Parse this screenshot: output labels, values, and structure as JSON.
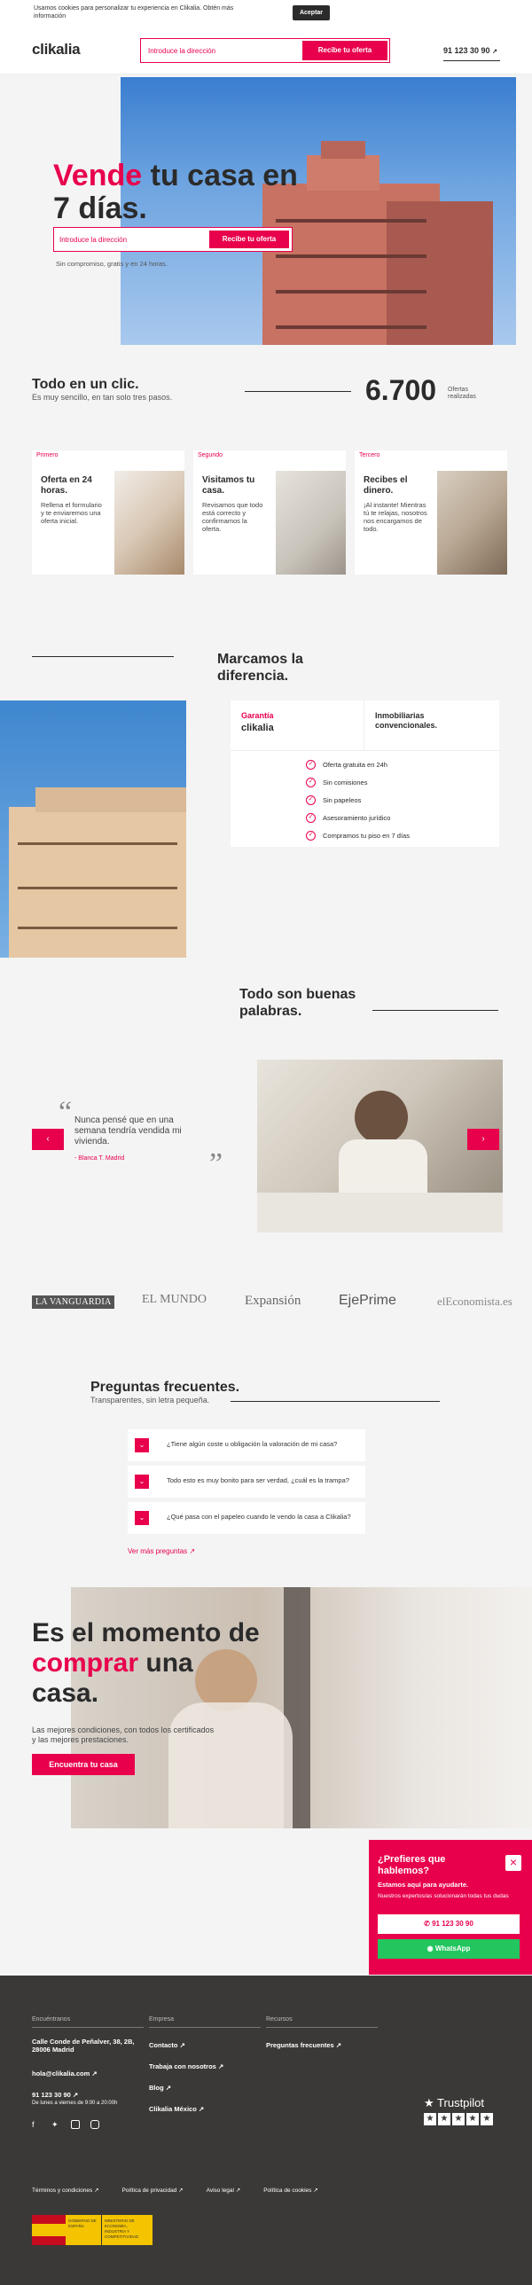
{
  "cookie": {
    "text": "Usamos cookies para personalizar tu experiencia en Clikalia. Obtén más información",
    "accept": "Aceptar"
  },
  "header": {
    "logo": "clikalia",
    "search_placeholder": "Introduce la dirección",
    "search_button": "Recibe tu oferta",
    "phone": "91 123 30 90"
  },
  "hero": {
    "title_highlight": "Vende",
    "title_rest": " tu casa en 7 días.",
    "search_placeholder": "Introduce la dirección",
    "search_button": "Recibe tu oferta",
    "subtitle": "Sin compromiso, gratis y en 24 horas."
  },
  "intro": {
    "title": "Todo en un clic.",
    "subtitle": "Es muy sencillo, en tan solo tres pasos.",
    "count": "6.700",
    "count_label": "Ofertas realizadas"
  },
  "steps": [
    {
      "label": "Primero",
      "title": "Oferta en 24 horas.",
      "desc": "Rellena el formulario y te enviaremos una oferta inicial."
    },
    {
      "label": "Segundo",
      "title": "Visitamos tu casa.",
      "desc": "Revisamos que todo está correcto y confirmamos la oferta."
    },
    {
      "label": "Tercero",
      "title": "Recibes el dinero.",
      "desc": "¡Al instante! Mientras tú te relajas, nosotros nos encargamos de todo."
    }
  ],
  "difference": {
    "title": "Marcamos la diferencia.",
    "col1_title": "Garantía",
    "col1_logo": "clikalia",
    "col2_title": "Inmobiliarias convencionales.",
    "rows": [
      "Oferta gratuita en 24h",
      "Sin comisiones",
      "Sin papeleos",
      "Asesoramiento jurídico",
      "Compramos tu piso en 7 días"
    ]
  },
  "testimonials": {
    "title": "Todo son buenas palabras.",
    "quote": "Nunca pensé que en una semana tendría vendida mi vivienda.",
    "author": "- Blanca T. Madrid",
    "prev": "‹",
    "next": "›"
  },
  "press": [
    "LA VANGUARDIA",
    "EL MUNDO",
    "Expansión",
    "EjePrime",
    "elEconomista.es"
  ],
  "faq": {
    "title": "Preguntas frecuentes.",
    "subtitle": "Transparentes, sin letra pequeña.",
    "questions": [
      "¿Tiene algún coste u obligación la valoración de mi casa?",
      "Todo esto es muy bonito para ser verdad, ¿cuál es la trampa?",
      "¿Qué pasa con el papeleo cuando le vendo la casa a Clikalia?"
    ],
    "more": "Ver más preguntas"
  },
  "cta": {
    "line1": "Es el momento de",
    "line2_highlight": "comprar",
    "line2_rest": " una",
    "line3": "casa.",
    "desc": "Las mejores condiciones, con todos los certificados y las mejores prestaciones.",
    "button": "Encuentra tu casa"
  },
  "contact": {
    "title": "¿Prefieres que hablemos?",
    "subtitle": "Estamos aquí para ayudarte.",
    "desc": "Nuestros expertos/as solucionarán todas tus dudas",
    "phone": "91 123 30 90",
    "whatsapp": "WhatsApp",
    "close": "×"
  },
  "footer": {
    "col1_head": "Encuéntranos",
    "address": "Calle Conde de Peñalver, 38, 2B, 28006 Madrid",
    "email": "hola@clikalia.com",
    "phone": "91 123 30 90",
    "hours": "De lunes a viernes de 9:00 a 20:00h",
    "col2_head": "Empresa",
    "col2_links": [
      "Contacto",
      "Trabaja con nosotros",
      "Blog",
      "Clikalia México"
    ],
    "col3_head": "Recursos",
    "col3_links": [
      "Preguntas frecuentes"
    ],
    "trustpilot": "Trustpilot",
    "legal": [
      "Términos y condiciones",
      "Política de privacidad",
      "Aviso legal",
      "Política de cookies"
    ],
    "gov1": "GOBIERNO DE ESPAÑA",
    "gov2": "MINISTERIO DE ECONOMÍA, INDUSTRIA Y COMPETITIVIDAD"
  }
}
